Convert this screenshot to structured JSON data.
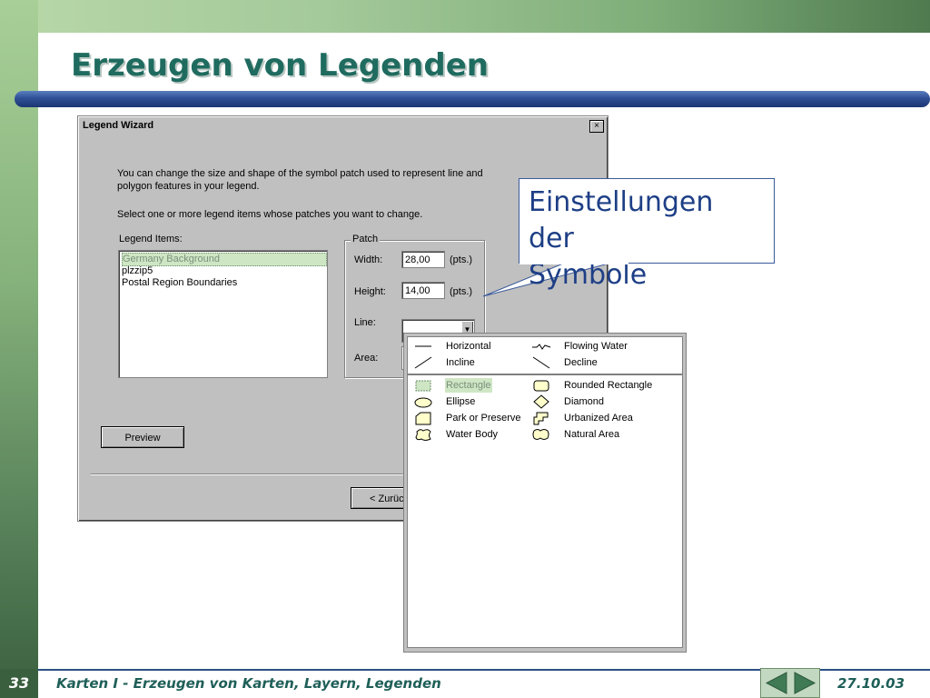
{
  "slide": {
    "title": "Erzeugen von Legenden",
    "number": "33",
    "footer_text": "Karten I - Erzeugen von Karten, Layern, Legenden",
    "date": "27.10.03"
  },
  "dialog": {
    "title": "Legend Wizard",
    "close_glyph": "×",
    "intro_line1": "You can change the size and shape of the symbol patch used to represent line and",
    "intro_line2": "polygon features in your legend.",
    "intro_line3": "Select one or more legend items whose patches you want to change.",
    "legend_items_label": "Legend Items:",
    "legend_items": [
      "Germany Background",
      "plzzip5",
      "Postal Region Boundaries"
    ],
    "patch": {
      "caption": "Patch",
      "width_label": "Width:",
      "width_value": "28,00",
      "height_label": "Height:",
      "height_value": "14,00",
      "unit": "(pts.)",
      "line_label": "Line:",
      "area_label": "Area:"
    },
    "preview_label": "Preview",
    "back_label": "< Zurück"
  },
  "callout": {
    "line1": "Einstellungen der",
    "line2": "Symbole"
  },
  "palette": {
    "line_symbols": [
      {
        "label": "Horizontal",
        "icon": "horizontal-line-icon"
      },
      {
        "label": "Flowing Water",
        "icon": "flowing-water-icon"
      },
      {
        "label": "Incline",
        "icon": "incline-line-icon"
      },
      {
        "label": "Decline",
        "icon": "decline-line-icon"
      }
    ],
    "area_symbols": [
      {
        "label": "Rectangle",
        "icon": "rectangle-icon"
      },
      {
        "label": "Rounded Rectangle",
        "icon": "rounded-rectangle-icon"
      },
      {
        "label": "Ellipse",
        "icon": "ellipse-icon"
      },
      {
        "label": "Diamond",
        "icon": "diamond-icon"
      },
      {
        "label": "Park or Preserve",
        "icon": "park-icon"
      },
      {
        "label": "Urbanized Area",
        "icon": "urbanized-icon"
      },
      {
        "label": "Water Body",
        "icon": "water-body-icon"
      },
      {
        "label": "Natural Area",
        "icon": "natural-area-icon"
      }
    ],
    "symbol_fill": "#ffffcc"
  }
}
